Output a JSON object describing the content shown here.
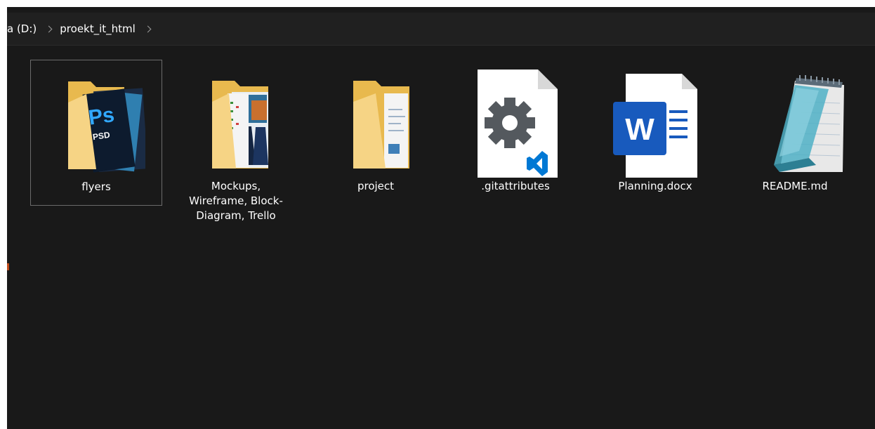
{
  "breadcrumb": {
    "drive": "a (D:)",
    "folder": "proekt_it_html"
  },
  "items": [
    {
      "label": "flyers",
      "type": "folder",
      "icon": "photoshop-folder-icon",
      "selected": true
    },
    {
      "label": "Mockups, Wireframe, Block-Diagram, Trello",
      "type": "folder",
      "icon": "image-folder-icon",
      "selected": false
    },
    {
      "label": "project",
      "type": "folder",
      "icon": "document-folder-icon",
      "selected": false
    },
    {
      "label": ".gitattributes",
      "type": "file",
      "icon": "vscode-settings-file-icon",
      "selected": false
    },
    {
      "label": "Planning.docx",
      "type": "file",
      "icon": "word-document-icon",
      "selected": false
    },
    {
      "label": "README.md",
      "type": "file",
      "icon": "notepad-icon",
      "selected": false
    }
  ],
  "colors": {
    "background": "#191919",
    "folder": "#f5d27a",
    "word_blue": "#185abd",
    "vscode_blue": "#0078d4"
  }
}
